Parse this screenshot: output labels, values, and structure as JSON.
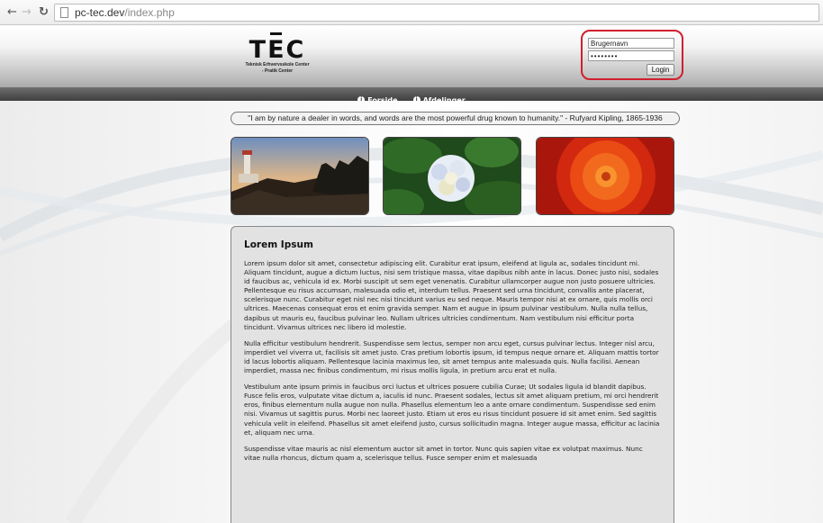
{
  "browser": {
    "url_host": "pc-tec.dev",
    "url_path": "/index.php"
  },
  "header": {
    "logo_word": "TEC",
    "logo_line1": "Teknisk Erhvervsskole Center",
    "logo_line2": "- Pratik Center"
  },
  "login": {
    "username_value": "Brugernavn",
    "password_value": "••••••••",
    "button_label": "Login",
    "highlight_color": "#d0202e"
  },
  "nav": {
    "items": [
      {
        "label": "Forside",
        "icon": "info-icon"
      },
      {
        "label": "Afdelinger",
        "icon": "info-icon"
      }
    ]
  },
  "quote": "\"I am by nature a dealer in words, and words are the most powerful drug known to humanity.\" - Rufyard Kipling, 1865-1936",
  "article": {
    "title": "Lorem Ipsum",
    "paragraphs": [
      "Lorem ipsum dolor sit amet, consectetur adipiscing elit. Curabitur erat ipsum, eleifend at ligula ac, sodales tincidunt mi. Aliquam tincidunt, augue a dictum luctus, nisi sem tristique massa, vitae dapibus nibh ante in lacus. Donec justo nisi, sodales id faucibus ac, vehicula id ex. Morbi suscipit ut sem eget venenatis. Curabitur ullamcorper augue non justo posuere ultricies. Pellentesque eu risus accumsan, malesuada odio et, interdum tellus. Praesent sed urna tincidunt, convallis ante placerat, scelerisque nunc. Curabitur eget nisl nec nisi tincidunt varius eu sed neque. Mauris tempor nisi at ex ornare, quis mollis orci ultrices. Maecenas consequat eros et enim gravida semper. Nam et augue in ipsum pulvinar vestibulum. Nulla nulla tellus, dapibus ut mauris eu, faucibus pulvinar leo. Nullam ultrices ultricies condimentum. Nam vestibulum nisi efficitur porta tincidunt. Vivamus ultrices nec libero id molestie.",
      "Nulla efficitur vestibulum hendrerit. Suspendisse sem lectus, semper non arcu eget, cursus pulvinar lectus. Integer nisl arcu, imperdiet vel viverra ut, facilisis sit amet justo. Cras pretium lobortis ipsum, id tempus neque ornare et. Aliquam mattis tortor id lacus lobortis aliquam. Pellentesque lacinia maximus leo, sit amet tempus ante malesuada quis. Nulla facilisi. Aenean imperdiet, massa nec finibus condimentum, mi risus mollis ligula, in pretium arcu erat et nulla.",
      "Vestibulum ante ipsum primis in faucibus orci luctus et ultrices posuere cubilia Curae; Ut sodales ligula id blandit dapibus. Fusce felis eros, vulputate vitae dictum a, iaculis id nunc. Praesent sodales, lectus sit amet aliquam pretium, mi orci hendrerit eros, finibus elementum nulla augue non nulla. Phasellus elementum leo a ante ornare condimentum. Suspendisse sed enim nisi. Vivamus ut sagittis purus. Morbi nec laoreet justo. Etiam ut eros eu risus tincidunt posuere id sit amet enim. Sed sagittis vehicula velit in eleifend. Phasellus sit amet eleifend justo, cursus sollicitudin magna. Integer augue massa, efficitur ac lacinia et, aliquam nec urna.",
      "Suspendisse vitae mauris ac nisl elementum auctor sit amet in tortor. Nunc quis sapien vitae ex volutpat maximus. Nunc vitae nulla rhoncus, dictum quam a, scelerisque tellus. Fusce semper enim et malesuada"
    ]
  }
}
